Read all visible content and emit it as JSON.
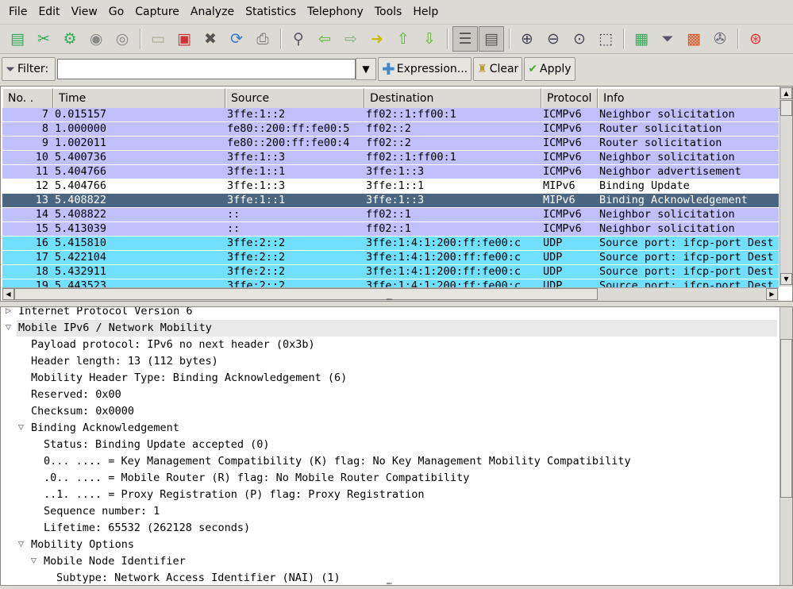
{
  "menu": [
    "File",
    "Edit",
    "View",
    "Go",
    "Capture",
    "Analyze",
    "Statistics",
    "Telephony",
    "Tools",
    "Help"
  ],
  "toolbar": [
    {
      "icon": "interfaces-icon",
      "glyph": "▤",
      "color": "#3a5"
    },
    {
      "icon": "capture-options-icon",
      "glyph": "✂",
      "color": "#3a5"
    },
    {
      "icon": "start-capture-icon",
      "glyph": "⚙",
      "color": "#3a5"
    },
    {
      "icon": "stop-capture-icon",
      "glyph": "◉",
      "color": "#888"
    },
    {
      "icon": "restart-capture-icon",
      "glyph": "◎",
      "color": "#888"
    },
    {
      "sep": true
    },
    {
      "icon": "open-file-icon",
      "glyph": "▭",
      "color": "#aa9"
    },
    {
      "icon": "save-file-icon",
      "glyph": "▣",
      "color": "#c33"
    },
    {
      "icon": "close-file-icon",
      "glyph": "✖",
      "color": "#555"
    },
    {
      "icon": "reload-icon",
      "glyph": "⟳",
      "color": "#37c"
    },
    {
      "icon": "print-icon",
      "glyph": "⎙",
      "color": "#777"
    },
    {
      "sep": true
    },
    {
      "icon": "find-packet-icon",
      "glyph": "⚲",
      "color": "#556"
    },
    {
      "icon": "go-back-icon",
      "glyph": "⇦",
      "color": "#5b2"
    },
    {
      "icon": "go-forward-icon",
      "glyph": "⇨",
      "color": "#8a8"
    },
    {
      "icon": "go-to-packet-icon",
      "glyph": "➜",
      "color": "#cb0"
    },
    {
      "icon": "go-first-icon",
      "glyph": "⇧",
      "color": "#5b2"
    },
    {
      "icon": "go-last-icon",
      "glyph": "⇩",
      "color": "#5b2"
    },
    {
      "sep": true
    },
    {
      "icon": "colorize-icon",
      "glyph": "☰",
      "color": "#555",
      "pressed": true
    },
    {
      "icon": "auto-scroll-icon",
      "glyph": "▤",
      "color": "#555",
      "pressed": true
    },
    {
      "sep": true
    },
    {
      "icon": "zoom-in-icon",
      "glyph": "⊕",
      "color": "#445"
    },
    {
      "icon": "zoom-out-icon",
      "glyph": "⊖",
      "color": "#445"
    },
    {
      "icon": "zoom-normal-icon",
      "glyph": "⊙",
      "color": "#445"
    },
    {
      "icon": "resize-columns-icon",
      "glyph": "⬚",
      "color": "#445"
    },
    {
      "sep": true
    },
    {
      "icon": "capture-filters-icon",
      "glyph": "▦",
      "color": "#3a5"
    },
    {
      "icon": "display-filters-icon",
      "glyph": "⏷",
      "color": "#556"
    },
    {
      "icon": "coloring-rules-icon",
      "glyph": "▩",
      "color": "#d52"
    },
    {
      "icon": "preferences-icon",
      "glyph": "✇",
      "color": "#667"
    },
    {
      "sep": true
    },
    {
      "icon": "help-icon",
      "glyph": "⊛",
      "color": "#d33"
    }
  ],
  "filter": {
    "label": "Filter:",
    "value": "",
    "expression": "Expression...",
    "clear": "Clear",
    "apply": "Apply"
  },
  "columns": [
    "No. .",
    "Time",
    "Source",
    "Destination",
    "Protocol",
    "Info"
  ],
  "colors": {
    "icmpv6": "#c0c0fc",
    "udp": "#70e0fe",
    "mipv6": "#ffffff",
    "selected": "#4a6680"
  },
  "packets": [
    {
      "no": "7",
      "time": "0.015157",
      "src": "3ffe:1::2",
      "dst": "ff02::1:ff00:1",
      "proto": "ICMPv6",
      "info": "Neighbor solicitation",
      "kind": "icmpv6"
    },
    {
      "no": "8",
      "time": "1.000000",
      "src": "fe80::200:ff:fe00:5",
      "dst": "ff02::2",
      "proto": "ICMPv6",
      "info": "Router solicitation",
      "kind": "icmpv6"
    },
    {
      "no": "9",
      "time": "1.002011",
      "src": "fe80::200:ff:fe00:4",
      "dst": "ff02::2",
      "proto": "ICMPv6",
      "info": "Router solicitation",
      "kind": "icmpv6"
    },
    {
      "no": "10",
      "time": "5.400736",
      "src": "3ffe:1::3",
      "dst": "ff02::1:ff00:1",
      "proto": "ICMPv6",
      "info": "Neighbor solicitation",
      "kind": "icmpv6"
    },
    {
      "no": "11",
      "time": "5.404766",
      "src": "3ffe:1::1",
      "dst": "3ffe:1::3",
      "proto": "ICMPv6",
      "info": "Neighbor advertisement",
      "kind": "icmpv6"
    },
    {
      "no": "12",
      "time": "5.404766",
      "src": "3ffe:1::3",
      "dst": "3ffe:1::1",
      "proto": "MIPv6",
      "info": "Binding Update",
      "kind": "mipv6"
    },
    {
      "no": "13",
      "time": "5.408822",
      "src": "3ffe:1::1",
      "dst": "3ffe:1::3",
      "proto": "MIPv6",
      "info": "Binding Acknowledgement",
      "kind": "selected"
    },
    {
      "no": "14",
      "time": "5.408822",
      "src": "::",
      "dst": "ff02::1",
      "proto": "ICMPv6",
      "info": "Neighbor solicitation",
      "kind": "icmpv6"
    },
    {
      "no": "15",
      "time": "5.413039",
      "src": "::",
      "dst": "ff02::1",
      "proto": "ICMPv6",
      "info": "Neighbor solicitation",
      "kind": "icmpv6"
    },
    {
      "no": "16",
      "time": "5.415810",
      "src": "3ffe:2::2",
      "dst": "3ffe:1:4:1:200:ff:fe00:c",
      "proto": "UDP",
      "info": "Source port: ifcp-port  Dest",
      "kind": "udp"
    },
    {
      "no": "17",
      "time": "5.422104",
      "src": "3ffe:2::2",
      "dst": "3ffe:1:4:1:200:ff:fe00:c",
      "proto": "UDP",
      "info": "Source port: ifcp-port  Dest",
      "kind": "udp"
    },
    {
      "no": "18",
      "time": "5.432911",
      "src": "3ffe:2::2",
      "dst": "3ffe:1:4:1:200:ff:fe00:c",
      "proto": "UDP",
      "info": "Source port: ifcp-port  Dest",
      "kind": "udp"
    },
    {
      "no": "19",
      "time": "5.443523",
      "src": "3ffe:2::2",
      "dst": "3ffe:1:4:1:200:ff:fe00:c",
      "proto": "UDP",
      "info": "Source port: ifcp-port  Dest",
      "kind": "udp"
    }
  ],
  "details": [
    {
      "level": 0,
      "text": "Internet Protocol Version 6",
      "arrow": "collapsed"
    },
    {
      "level": 0,
      "text": "Mobile IPv6 / Network Mobility",
      "arrow": "expanded",
      "highlight": true
    },
    {
      "level": 1,
      "text": "Payload protocol: IPv6 no next header (0x3b)"
    },
    {
      "level": 1,
      "text": "Header length: 13 (112 bytes)"
    },
    {
      "level": 1,
      "text": "Mobility Header Type: Binding Acknowledgement (6)"
    },
    {
      "level": 1,
      "text": "Reserved: 0x00"
    },
    {
      "level": 1,
      "text": "Checksum: 0x0000"
    },
    {
      "level": 1,
      "text": "Binding Acknowledgement",
      "arrow": "expanded"
    },
    {
      "level": 2,
      "text": "Status: Binding Update accepted (0)"
    },
    {
      "level": 2,
      "text": "0... .... = Key Management Compatibility (K) flag: No Key Management Mobility Compatibility"
    },
    {
      "level": 2,
      "text": ".0.. .... = Mobile Router (R) flag: No Mobile Router Compatibility"
    },
    {
      "level": 2,
      "text": "..1. .... = Proxy Registration (P) flag: Proxy Registration"
    },
    {
      "level": 2,
      "text": "Sequence number: 1"
    },
    {
      "level": 2,
      "text": "Lifetime: 65532 (262128 seconds)"
    },
    {
      "level": 1,
      "text": "Mobility Options",
      "arrow": "expanded"
    },
    {
      "level": 2,
      "text": "Mobile Node Identifier",
      "arrow": "expanded"
    },
    {
      "level": 3,
      "text": "Subtype: Network Access Identifier (NAI) (1)"
    }
  ]
}
